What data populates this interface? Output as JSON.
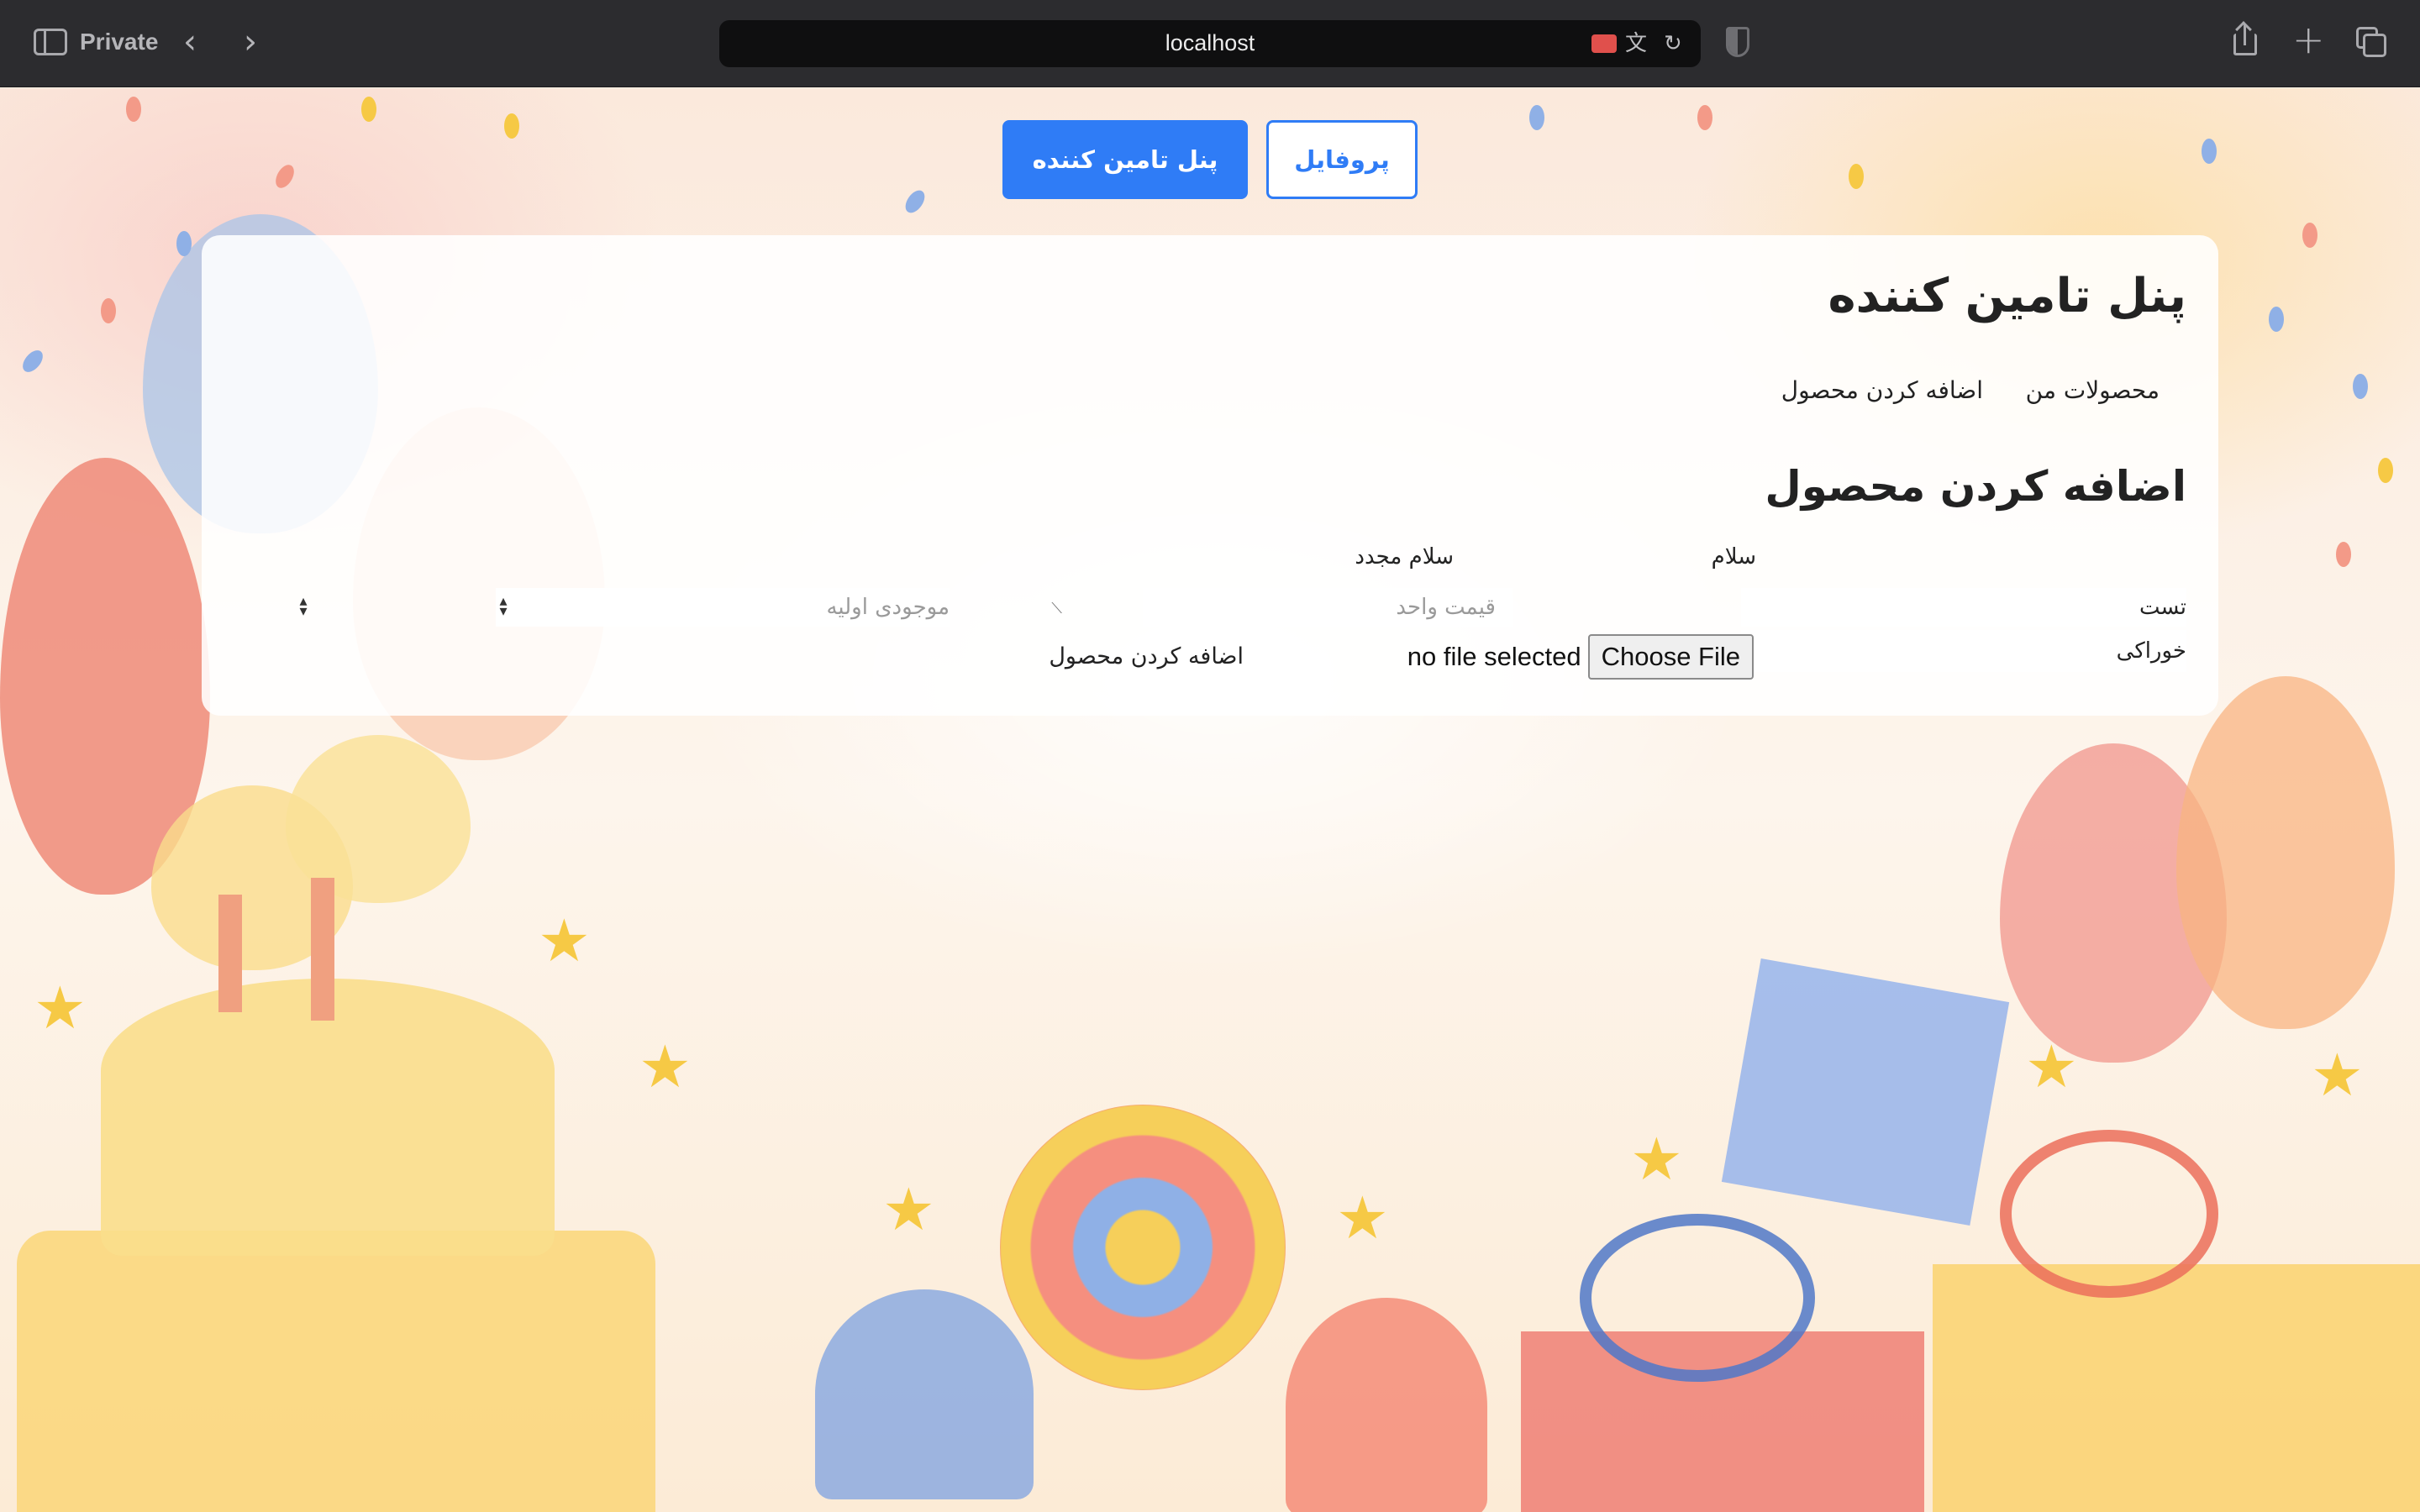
{
  "browser": {
    "mode_label": "Private",
    "url": "localhost"
  },
  "nav": {
    "profile_label": "پروفایل",
    "supplier_panel_label": "پنل تامین کننده"
  },
  "panel": {
    "title": "پنل تامین کننده",
    "tabs": [
      {
        "label": "محصولات من"
      },
      {
        "label": "اضافه کردن محصول"
      }
    ]
  },
  "form": {
    "title": "اضافه کردن محصول",
    "name_label": "سلام",
    "greeting2_label": "سلام مجدد",
    "title_value": "تست",
    "description_value": "",
    "price_placeholder": "قیمت واحد",
    "stock_placeholder": "موجودی اولیه",
    "category_value": "خوراکی",
    "file_status": "no file selected",
    "file_button_label": "Choose File",
    "submit_label": "اضافه کردن محصول"
  },
  "colors": {
    "primary": "#2f7cf6",
    "toolbar": "#2c2c2f",
    "url_bar": "#0f0f10"
  }
}
